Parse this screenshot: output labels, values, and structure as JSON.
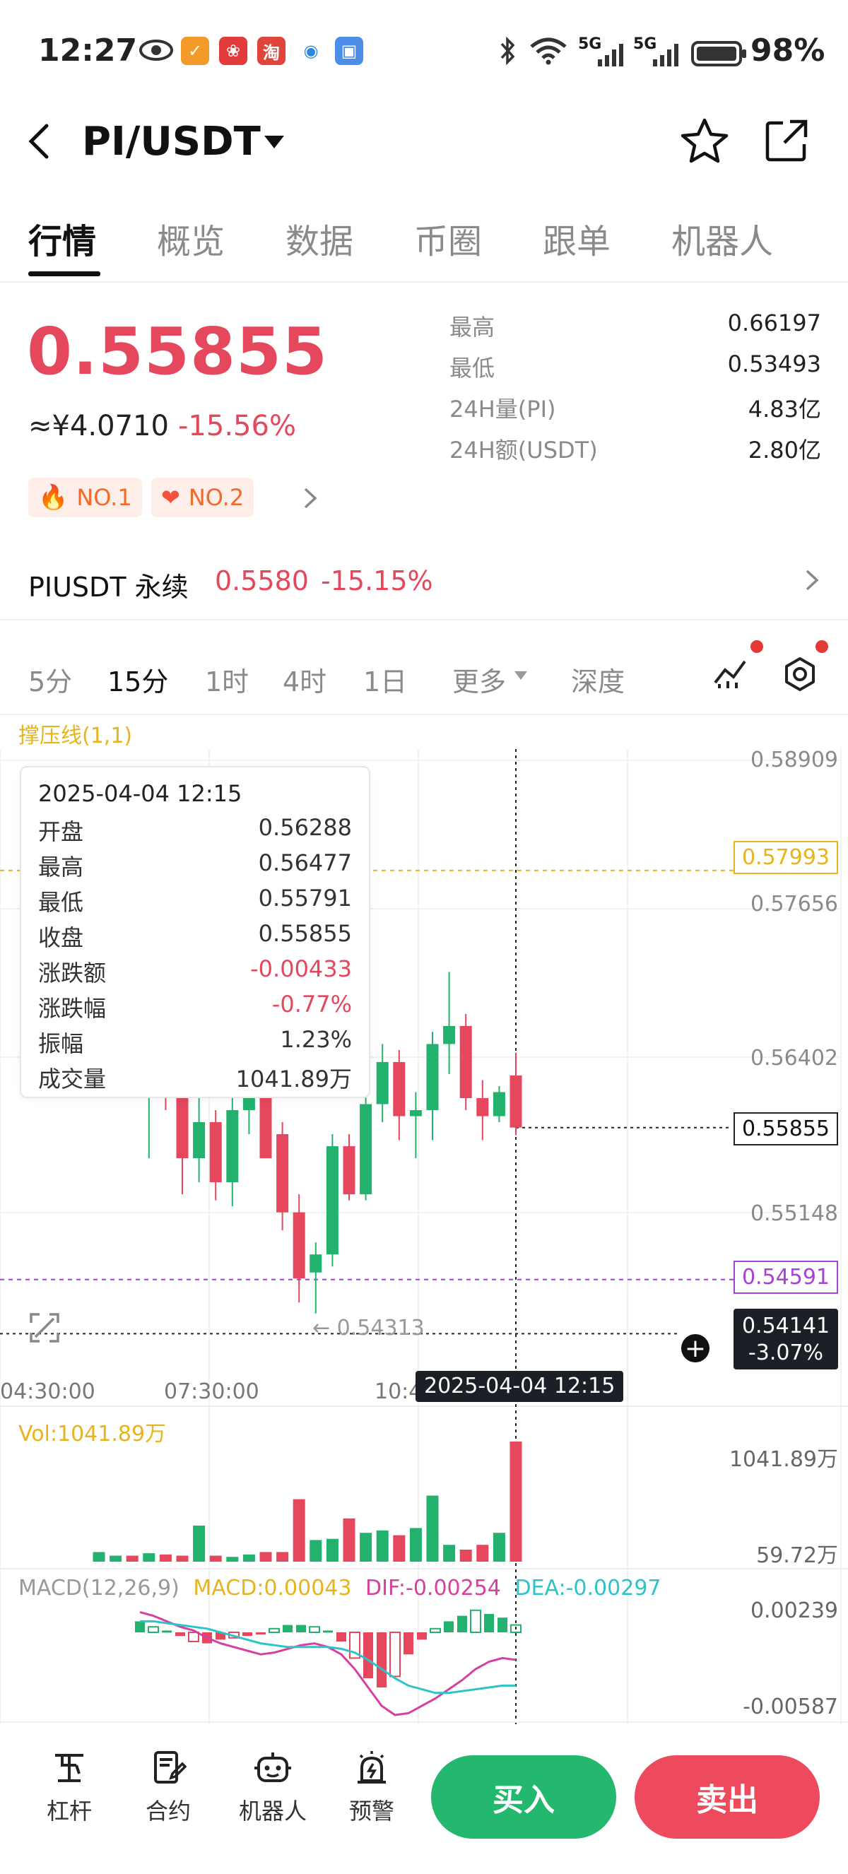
{
  "status_bar": {
    "time": "12:27",
    "network1": "5G",
    "network2": "5G",
    "battery": "98%"
  },
  "header": {
    "pair": "PI/USDT"
  },
  "tabs": [
    "行情",
    "概览",
    "数据",
    "币圈",
    "跟单",
    "机器人"
  ],
  "ticker": {
    "price": "0.55855",
    "cny": "≈¥4.0710",
    "change": "-15.56%",
    "badges": [
      "NO.1",
      "NO.2"
    ],
    "stats": [
      {
        "label": "最高",
        "value": "0.66197"
      },
      {
        "label": "最低",
        "value": "0.53493"
      },
      {
        "label": "24H量(PI)",
        "value": "4.83亿"
      },
      {
        "label": "24H额(USDT)",
        "value": "2.80亿"
      }
    ]
  },
  "perpetual": {
    "name": "PIUSDT 永续",
    "price": "0.5580",
    "change": "-15.15%"
  },
  "intervals": [
    "5分",
    "15分",
    "1时",
    "4时",
    "1日",
    "更多",
    "深度"
  ],
  "active_interval": "15分",
  "indicator_label": "撑压线(1,1)",
  "price_axis": [
    "0.58909",
    "0.57656",
    "0.56402",
    "0.55148"
  ],
  "tags": {
    "resistance": "0.57993",
    "current": "0.55855",
    "support": "0.54591",
    "crosshair_price": "0.54141",
    "crosshair_change": "-3.07%",
    "low_marker": "← 0.54313"
  },
  "time_axis": [
    "04:30:00",
    "07:30:00",
    "10:4"
  ],
  "crosshair_time": "2025-04-04 12:15",
  "tooltip": {
    "datetime": "2025-04-04 12:15",
    "rows": [
      {
        "label": "开盘",
        "value": "0.56288",
        "color": "#333333"
      },
      {
        "label": "最高",
        "value": "0.56477",
        "color": "#333333"
      },
      {
        "label": "最低",
        "value": "0.55791",
        "color": "#333333"
      },
      {
        "label": "收盘",
        "value": "0.55855",
        "color": "#333333"
      },
      {
        "label": "涨跌额",
        "value": "-0.00433",
        "color": "#e5475d"
      },
      {
        "label": "涨跌幅",
        "value": "-0.77%",
        "color": "#e5475d"
      },
      {
        "label": "振幅",
        "value": "1.23%",
        "color": "#333333"
      },
      {
        "label": "成交量",
        "value": "1041.89万",
        "color": "#333333"
      }
    ]
  },
  "volume": {
    "label": "Vol:1041.89万",
    "max": "1041.89万",
    "min": "59.72万"
  },
  "macd": {
    "title": "MACD(12,26,9)",
    "macd": "MACD:0.00043",
    "dif": "DIF:-0.00254",
    "dea": "DEA:-0.00297",
    "top": "0.00239",
    "bottom": "-0.00587"
  },
  "bottom_nav": [
    "杠杆",
    "合约",
    "机器人",
    "预警"
  ],
  "actions": {
    "buy": "买入",
    "sell": "卖出"
  },
  "colors": {
    "up": "#23b26d",
    "down": "#e5475d",
    "accent_yellow": "#e8b41d",
    "purple": "#a642d6"
  },
  "candles": [
    {
      "o": 0.5765,
      "h": 0.582,
      "l": 0.572,
      "c": 0.579
    },
    {
      "o": 0.577,
      "h": 0.58,
      "l": 0.574,
      "c": 0.5795
    },
    {
      "o": 0.577,
      "h": 0.578,
      "l": 0.5715,
      "c": 0.573
    },
    {
      "o": 0.565,
      "h": 0.572,
      "l": 0.556,
      "c": 0.569
    },
    {
      "o": 0.569,
      "h": 0.571,
      "l": 0.56,
      "c": 0.562
    },
    {
      "o": 0.562,
      "h": 0.566,
      "l": 0.553,
      "c": 0.556
    },
    {
      "o": 0.556,
      "h": 0.561,
      "l": 0.554,
      "c": 0.559
    },
    {
      "o": 0.559,
      "h": 0.56,
      "l": 0.5525,
      "c": 0.554
    },
    {
      "o": 0.554,
      "h": 0.562,
      "l": 0.552,
      "c": 0.56
    },
    {
      "o": 0.56,
      "h": 0.565,
      "l": 0.558,
      "c": 0.564
    },
    {
      "o": 0.564,
      "h": 0.565,
      "l": 0.556,
      "c": 0.556
    },
    {
      "o": 0.558,
      "h": 0.559,
      "l": 0.55,
      "c": 0.5515
    },
    {
      "o": 0.5515,
      "h": 0.553,
      "l": 0.544,
      "c": 0.546
    },
    {
      "o": 0.5465,
      "h": 0.549,
      "l": 0.5431,
      "c": 0.548
    },
    {
      "o": 0.548,
      "h": 0.558,
      "l": 0.547,
      "c": 0.557
    },
    {
      "o": 0.557,
      "h": 0.558,
      "l": 0.5525,
      "c": 0.553
    },
    {
      "o": 0.553,
      "h": 0.5615,
      "l": 0.5525,
      "c": 0.5605
    },
    {
      "o": 0.5605,
      "h": 0.5655,
      "l": 0.559,
      "c": 0.564
    },
    {
      "o": 0.564,
      "h": 0.565,
      "l": 0.5575,
      "c": 0.5595
    },
    {
      "o": 0.5595,
      "h": 0.5615,
      "l": 0.556,
      "c": 0.56
    },
    {
      "o": 0.56,
      "h": 0.5665,
      "l": 0.5575,
      "c": 0.5655
    },
    {
      "o": 0.5655,
      "h": 0.5715,
      "l": 0.563,
      "c": 0.567
    },
    {
      "o": 0.567,
      "h": 0.568,
      "l": 0.56,
      "c": 0.561
    },
    {
      "o": 0.561,
      "h": 0.5625,
      "l": 0.5575,
      "c": 0.5595
    },
    {
      "o": 0.5595,
      "h": 0.562,
      "l": 0.559,
      "c": 0.5615
    },
    {
      "o": 0.56288,
      "h": 0.56477,
      "l": 0.55791,
      "c": 0.55855
    }
  ],
  "volumes": [
    0.08,
    0.05,
    0.05,
    0.07,
    0.06,
    0.05,
    0.3,
    0.05,
    0.04,
    0.06,
    0.08,
    0.08,
    0.52,
    0.18,
    0.19,
    0.36,
    0.24,
    0.26,
    0.22,
    0.28,
    0.55,
    0.14,
    0.1,
    0.14,
    0.24,
    1.0
  ],
  "macd_hist": [
    0.0006,
    0.0003,
    0.0001,
    -0.0002,
    -0.0005,
    -0.0006,
    -0.0004,
    -0.0003,
    -0.0002,
    -0.0001,
    0.0002,
    0.0004,
    0.0004,
    0.0003,
    0.0001,
    -0.0005,
    -0.0014,
    -0.0025,
    -0.003,
    -0.0024,
    -0.0012,
    -0.0004,
    0.0002,
    0.0006,
    0.0009,
    0.0012,
    0.001,
    0.0008,
    0.0004
  ]
}
